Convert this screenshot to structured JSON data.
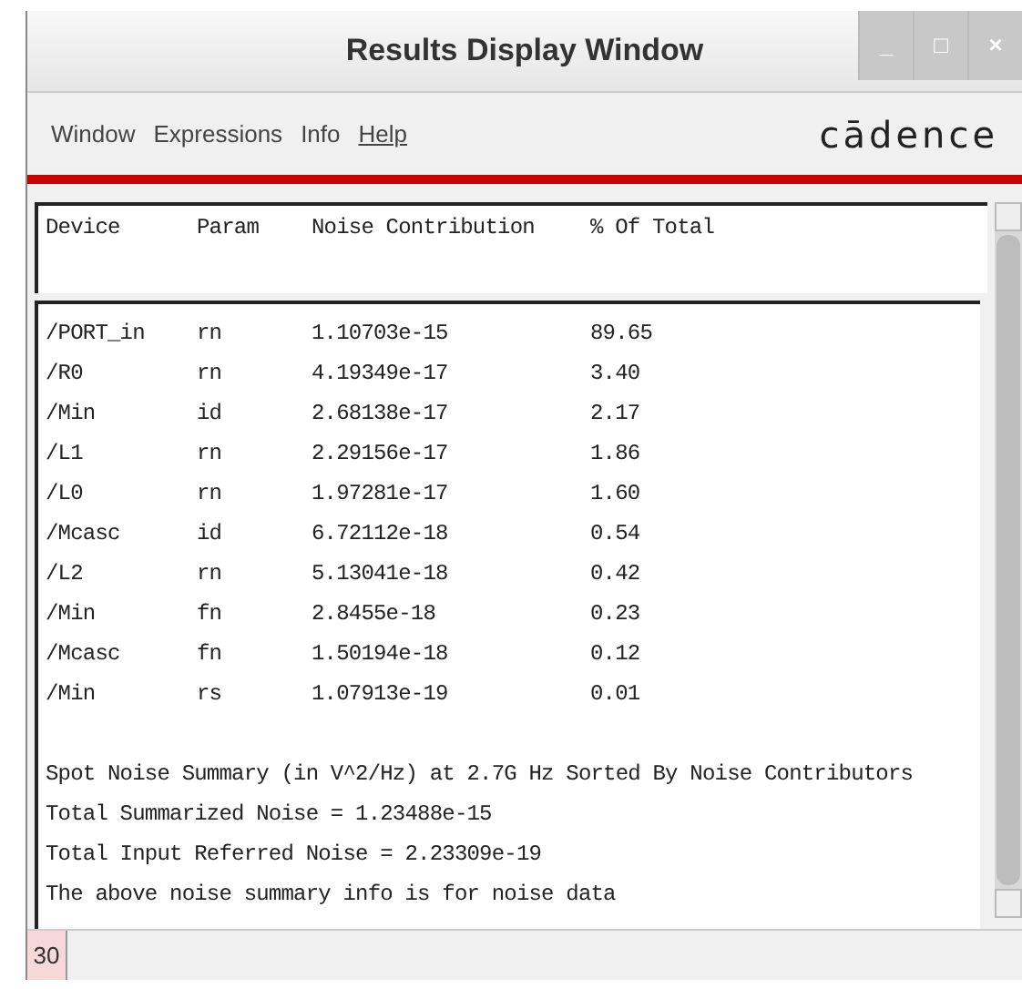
{
  "window": {
    "title": "Results Display Window",
    "controls": [
      "_",
      "□",
      "×"
    ]
  },
  "menu": [
    {
      "label": "Window",
      "mnemonic": false
    },
    {
      "label": "Expressions",
      "mnemonic": false
    },
    {
      "label": "Info",
      "mnemonic": false
    },
    {
      "label": "Help",
      "mnemonic": true
    }
  ],
  "logo": "cādence",
  "table": {
    "columns": [
      "Device",
      "Param",
      "Noise Contribution",
      "% Of Total"
    ],
    "rows": [
      [
        "/PORT_in",
        "rn",
        "1.10703e-15",
        "89.65"
      ],
      [
        "/R0",
        "rn",
        "4.19349e-17",
        "3.40"
      ],
      [
        "/Min",
        "id",
        "2.68138e-17",
        "2.17"
      ],
      [
        "/L1",
        "rn",
        "2.29156e-17",
        "1.86"
      ],
      [
        "/L0",
        "rn",
        "1.97281e-17",
        "1.60"
      ],
      [
        "/Mcasc",
        "id",
        "6.72112e-18",
        "0.54"
      ],
      [
        "/L2",
        "rn",
        "5.13041e-18",
        "0.42"
      ],
      [
        "/Min",
        "fn",
        "2.8455e-18",
        "0.23"
      ],
      [
        "/Mcasc",
        "fn",
        "1.50194e-18",
        "0.12"
      ],
      [
        "/Min",
        "rs",
        "1.07913e-19",
        "0.01"
      ]
    ]
  },
  "summary": [
    "Spot Noise Summary (in V^2/Hz) at 2.7G Hz Sorted By Noise Contributors",
    "Total Summarized Noise = 1.23488e-15",
    "Total Input Referred Noise = 2.23309e-19",
    "The above noise summary info is for noise data"
  ],
  "status_bar": {
    "line": "30"
  }
}
